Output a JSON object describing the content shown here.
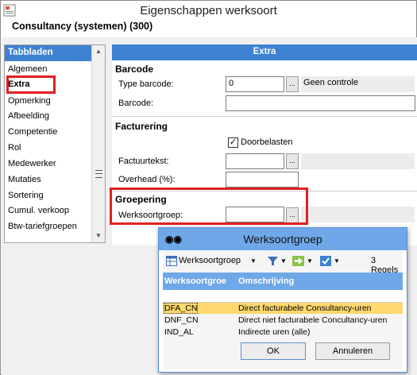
{
  "window": {
    "title": "Eigenschappen werksoort"
  },
  "subtitle": "Consultancy (systemen) (300)",
  "sidebar": {
    "header": "Tabbladen",
    "items": [
      {
        "label": "Algemeen"
      },
      {
        "label": "Extra"
      },
      {
        "label": "Opmerking"
      },
      {
        "label": "Afbeelding"
      },
      {
        "label": "Competentie"
      },
      {
        "label": "Rol"
      },
      {
        "label": "Medewerker"
      },
      {
        "label": "Mutaties"
      },
      {
        "label": "Sortering"
      },
      {
        "label": "Cumul. verkoop"
      },
      {
        "label": "Btw-tariefgroepen"
      }
    ],
    "selected": "Extra"
  },
  "panel": {
    "header": "Extra",
    "barcode": {
      "section": "Barcode",
      "type_label": "Type barcode:",
      "type_value": "0",
      "type_desc": "Geen controle",
      "barcode_label": "Barcode:",
      "barcode_value": ""
    },
    "facturering": {
      "section": "Facturering",
      "doorbelasten_label": "Doorbelasten",
      "doorbelasten_checked": true,
      "factuurtekst_label": "Factuurtekst:",
      "overhead_label": "Overhead (%):"
    },
    "groepering": {
      "section": "Groepering",
      "werksoortgroep_label": "Werksoortgroep:",
      "werksoortgroep_value": ""
    },
    "browse_label": "..."
  },
  "popup": {
    "title": "Werksoortgroep",
    "toolbar": {
      "dropdown_label": "Werksoortgroep",
      "count": "3 Regels"
    },
    "columns": [
      "Werksoortgroe",
      "Omschrijving"
    ],
    "rows": [
      {
        "code": "DFA_CN",
        "desc": "Direct facturabele Consultancy-uren"
      },
      {
        "code": "DNF_CN",
        "desc": "Direct niet facturabele Concultancy-uren"
      },
      {
        "code": "IND_AL",
        "desc": "Indirecte uren (alle)"
      }
    ],
    "selected_row": 0,
    "ok_label": "OK",
    "cancel_label": "Annuleren"
  }
}
